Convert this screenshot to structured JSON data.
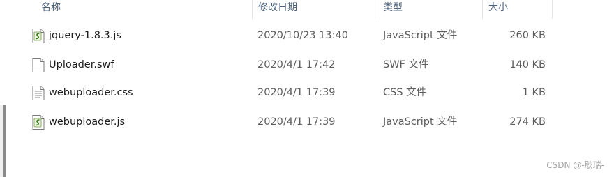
{
  "columns": {
    "name": "名称",
    "date": "修改日期",
    "type": "类型",
    "size": "大小"
  },
  "files": [
    {
      "name": "jquery-1.8.3.js",
      "date": "2020/10/23 13:40",
      "type": "JavaScript 文件",
      "size": "260 KB",
      "icon": "js-script-icon"
    },
    {
      "name": "Uploader.swf",
      "date": "2020/4/1 17:42",
      "type": "SWF 文件",
      "size": "140 KB",
      "icon": "blank-file-icon"
    },
    {
      "name": "webuploader.css",
      "date": "2020/4/1 17:39",
      "type": "CSS 文件",
      "size": "1 KB",
      "icon": "text-file-icon"
    },
    {
      "name": "webuploader.js",
      "date": "2020/4/1 17:39",
      "type": "JavaScript 文件",
      "size": "274 KB",
      "icon": "js-script-icon"
    }
  ],
  "watermark": "CSDN @-耿瑞-",
  "colors": {
    "header_text": "#4c607a",
    "secondary_text": "#5d5d5d",
    "script_icon_accent": "#c9a227"
  }
}
